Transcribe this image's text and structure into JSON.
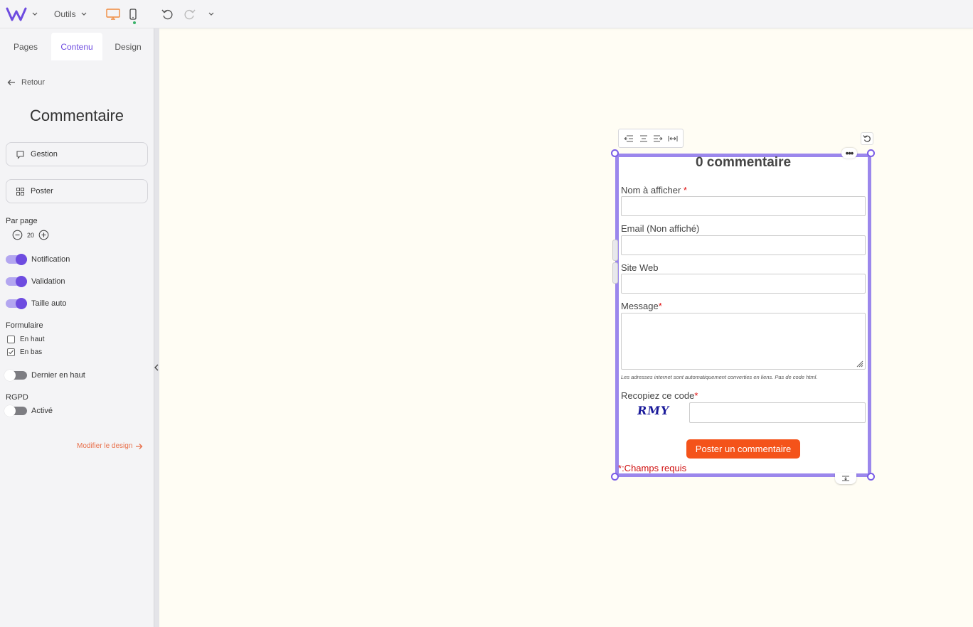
{
  "topbar": {
    "tools_label": "Outils"
  },
  "sidebar": {
    "tabs": [
      {
        "label": "Pages"
      },
      {
        "label": "Contenu"
      },
      {
        "label": "Design"
      }
    ],
    "back_label": "Retour",
    "title": "Commentaire",
    "gestion_label": "Gestion",
    "poster_label": "Poster",
    "per_page_label": "Par page",
    "per_page_value": "20",
    "toggles": [
      {
        "label": "Notification",
        "on": true
      },
      {
        "label": "Validation",
        "on": true
      },
      {
        "label": "Taille auto",
        "on": true
      }
    ],
    "form_section_label": "Formulaire",
    "form_options": [
      {
        "label": "En haut",
        "checked": false
      },
      {
        "label": "En bas",
        "checked": true
      }
    ],
    "last_on_top_label": "Dernier en haut",
    "rgpd_label": "RGPD",
    "rgpd_toggle_label": "Activé",
    "modify_design_label": "Modifier le design"
  },
  "widget": {
    "title": "0 commentaire",
    "name_label": "Nom à afficher ",
    "email_label": "Email (Non affiché)",
    "website_label": "Site Web",
    "message_label": "Message",
    "required_mark": "*",
    "hint": "Les adresses internet sont automatiquement converties en liens. Pas de code html.",
    "captcha_label": "Recopiez ce code",
    "captcha_text": "RMY",
    "submit_label": "Poster un commentaire",
    "required_note_mark": "*",
    "required_note": ":Champs requis"
  },
  "colors": {
    "accent": "#6e4ce0",
    "frame": "#9b87ec",
    "submit": "#f4531a",
    "link": "#e86f4a"
  }
}
